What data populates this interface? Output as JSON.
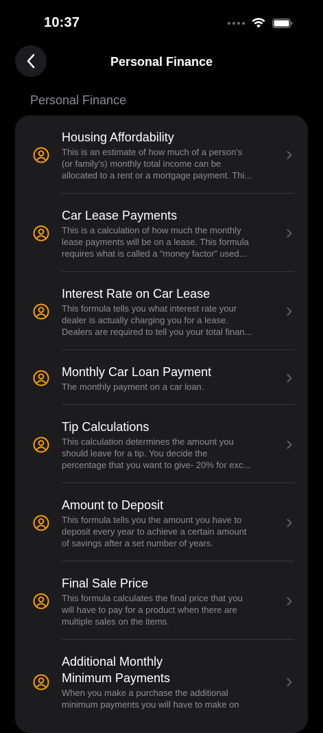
{
  "status_bar": {
    "time": "10:37"
  },
  "nav": {
    "title": "Personal Finance"
  },
  "section": {
    "header": "Personal Finance"
  },
  "colors": {
    "accent": "#FF9F0A",
    "background": "#000000",
    "card": "#1C1C1E",
    "secondary_text": "#8E8E93",
    "chevron": "#5E5E62"
  },
  "items": [
    {
      "title_lines": [
        "Housing Affordability"
      ],
      "desc_lines": [
        "This is an estimate of how much of a person's",
        "(or family's) monthly  total income can be",
        "allocated to a rent or a mortgage payment. Thi..."
      ],
      "icon": "person-circle-icon"
    },
    {
      "title_lines": [
        "Car Lease Payments"
      ],
      "desc_lines": [
        "This is a calculation of how much the monthly",
        "lease payments will be on a lease. This formula",
        "requires what is called a “money factor” used..."
      ],
      "icon": "person-circle-icon"
    },
    {
      "title_lines": [
        "Interest Rate on Car Lease"
      ],
      "desc_lines": [
        "This formula tells you what interest rate your",
        "dealer is actually charging you for a lease.",
        "Dealers are required to tell you your total finan..."
      ],
      "icon": "person-circle-icon"
    },
    {
      "title_lines": [
        "Monthly Car Loan Payment"
      ],
      "desc_lines": [
        "The monthly payment  on a car loan."
      ],
      "icon": "person-circle-icon"
    },
    {
      "title_lines": [
        "Tip Calculations"
      ],
      "desc_lines": [
        "This calculation determines the amount you",
        "should leave for a tip.  You decide the",
        "percentage that you want to give- 20% for exc..."
      ],
      "icon": "person-circle-icon"
    },
    {
      "title_lines": [
        "Amount to Deposit"
      ],
      "desc_lines": [
        "This formula tells you the amount you have to",
        "deposit every year to achieve a certain amount",
        "of savings after a set number of years."
      ],
      "icon": "person-circle-icon"
    },
    {
      "title_lines": [
        "Final Sale Price"
      ],
      "desc_lines": [
        "This formula calculates the final price that you",
        "will have to pay for a product when there are",
        "multiple sales on the items."
      ],
      "icon": "person-circle-icon"
    },
    {
      "title_lines": [
        "Additional Monthly",
        "Minimum Payments"
      ],
      "desc_lines": [
        "When you make a purchase  the additional",
        "minimum payments you will have to make on"
      ],
      "icon": "person-circle-icon"
    }
  ]
}
